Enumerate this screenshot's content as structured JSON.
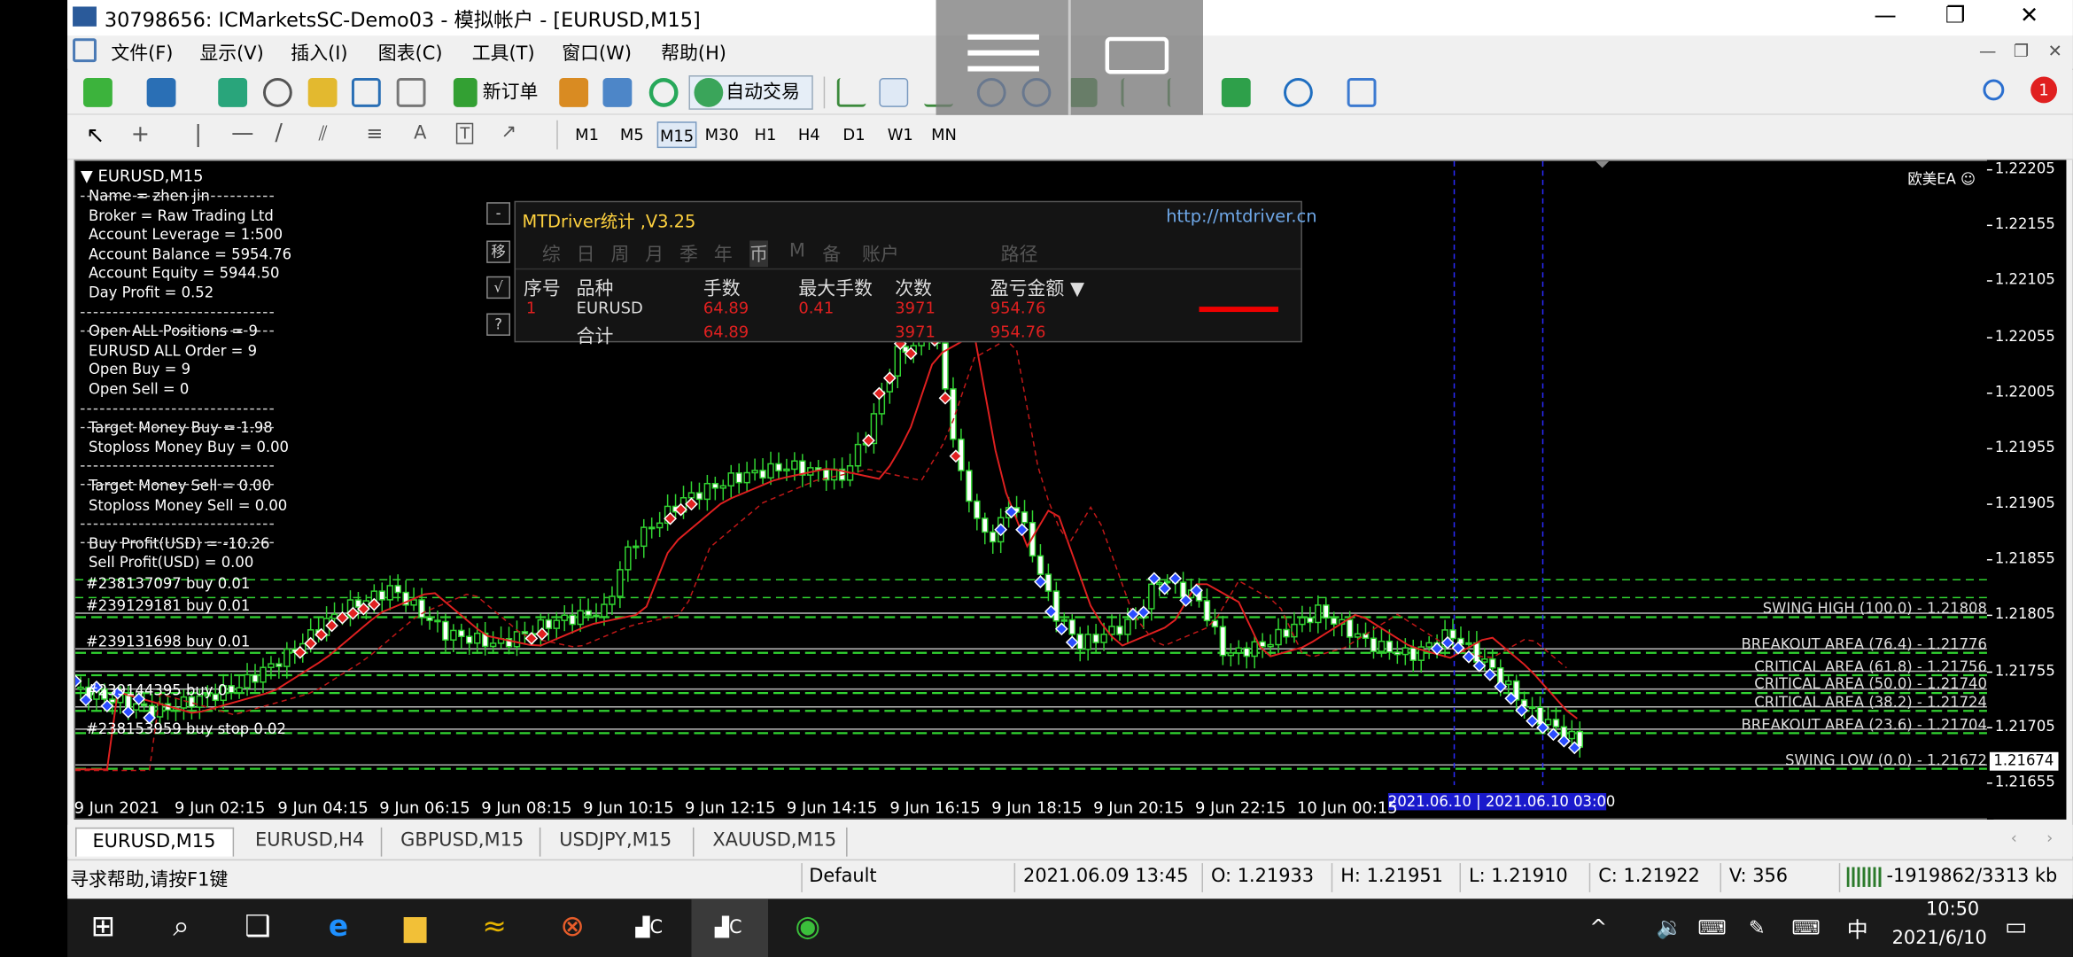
{
  "window": {
    "title": "30798656: ICMarketsSC-Demo03 - 模拟帐户 - [EURUSD,M15]"
  },
  "menu": [
    "文件(F)",
    "显示(V)",
    "插入(I)",
    "图表(C)",
    "工具(T)",
    "窗口(W)",
    "帮助(H)"
  ],
  "toolbar": {
    "new_order": "新订单",
    "auto_trading": "自动交易",
    "notification_count": "1"
  },
  "timeframes": [
    "M1",
    "M5",
    "M15",
    "M30",
    "H1",
    "H4",
    "D1",
    "W1",
    "MN"
  ],
  "active_timeframe": "M15",
  "chart": {
    "symbol_label": "EURUSD,M15",
    "ea_label": "欧美EA",
    "current_price": "1.21674",
    "price_ticks": [
      "1.22205",
      "1.22155",
      "1.22105",
      "1.22055",
      "1.22005",
      "1.21955",
      "1.21905",
      "1.21855",
      "1.21805",
      "1.21755",
      "1.21705",
      "1.21655"
    ],
    "time_ticks": [
      "9 Jun 2021",
      "9 Jun 02:15",
      "9 Jun 04:15",
      "9 Jun 06:15",
      "9 Jun 08:15",
      "9 Jun 10:15",
      "9 Jun 12:15",
      "9 Jun 14:15",
      "9 Jun 16:15",
      "9 Jun 18:15",
      "9 Jun 20:15",
      "9 Jun 22:15",
      "10 Jun 00:15"
    ],
    "time_highlight": "2021.06.10 | 2021.06.10 03:00",
    "fib_levels": [
      {
        "label": "SWING HIGH (100.0) - 1.21808",
        "price": 1.21808
      },
      {
        "label": "BREAKOUT AREA (76.4) - 1.21776",
        "price": 1.21776
      },
      {
        "label": "CRITICAL AREA (61.8) - 1.21756",
        "price": 1.21756
      },
      {
        "label": "CRITICAL AREA (50.0) - 1.21740",
        "price": 1.2174
      },
      {
        "label": "CRITICAL AREA (38.2) - 1.21724",
        "price": 1.21724
      },
      {
        "label": "BREAKOUT AREA (23.6) - 1.21704",
        "price": 1.21704
      },
      {
        "label": "SWING LOW (0.0) - 1.21672",
        "price": 1.21672
      }
    ],
    "order_labels": [
      "#238137097 buy 0.01",
      "#239129181 buy 0.01",
      "#239131698 buy 0.01",
      "#239144395 buy 0",
      "#238153959 buy stop 0.02"
    ]
  },
  "account_info": [
    "Name = zhen jin",
    "Broker = Raw Trading Ltd",
    "Account Leverage = 1:500",
    "Account Balance = 5954.76",
    "Account Equity = 5944.50",
    "Day Profit = 0.52",
    "",
    "Open ALL Positions = 9",
    "EURUSD ALL Order = 9",
    "Open Buy  = 9",
    "Open Sell = 0",
    "",
    "Target Money Buy = 1.98",
    "Stoploss Money Buy = 0.00",
    "",
    "Target Money Sell = 0.00",
    "Stoploss Money Sell = 0.00",
    "",
    "Buy Profit(USD) = -10.26",
    "Sell Profit(USD) = 0.00"
  ],
  "mtdriver": {
    "title": "MTDriver统计 ,V3.25",
    "url": "http://mtdriver.cn",
    "tabs": [
      "综",
      "日",
      "周",
      "月",
      "季",
      "年",
      "币",
      "M",
      "备",
      "账户",
      "路径"
    ],
    "side_buttons": [
      "-",
      "移",
      "√",
      "?"
    ],
    "headers": [
      "序号",
      "品种",
      "手数",
      "最大手数",
      "次数",
      "盈亏金额 ▼"
    ],
    "rows": [
      [
        "1",
        "EURUSD",
        "64.89",
        "0.41",
        "3971",
        "954.76"
      ]
    ],
    "total": [
      "合计",
      "64.89",
      "3971",
      "954.76"
    ]
  },
  "chart_tabs": [
    "EURUSD,M15",
    "EURUSD,H4",
    "GBPUSD,M15",
    "USDJPY,M15",
    "XAUUSD,M15"
  ],
  "status": {
    "help": "寻求帮助,请按F1键",
    "profile": "Default",
    "time": "2021.06.09 13:45",
    "open": "O: 1.21933",
    "high": "H: 1.21951",
    "low": "L: 1.21910",
    "close": "C: 1.21922",
    "volume": "V: 356",
    "traffic": "-1919862/3313 kb"
  },
  "taskbar": {
    "time": "10:50",
    "date": "2021/6/10",
    "ime": "中"
  }
}
